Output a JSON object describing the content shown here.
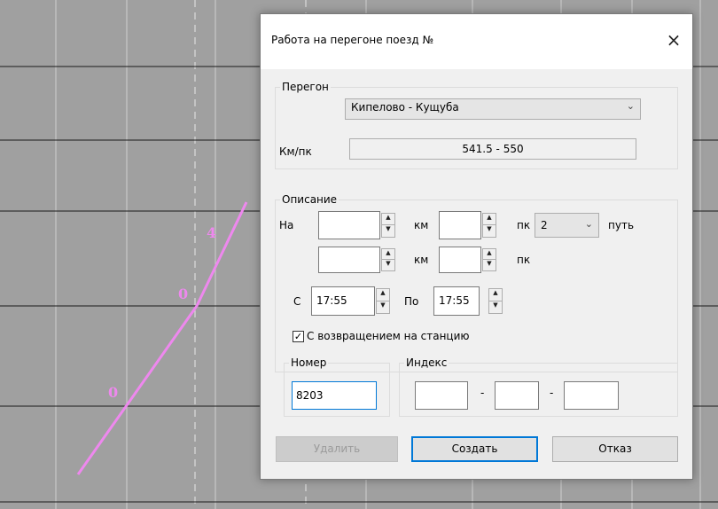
{
  "background": {
    "labels": [
      "4",
      "0",
      "0"
    ],
    "line_color": "#ee88ee"
  },
  "dialog": {
    "title": "Работа на перегоне поезд №",
    "close_icon": "×",
    "peregon": {
      "legend": "Перегон",
      "selected": "Кипелово - Кущуба",
      "km_pk_label": "Км/пк",
      "km_pk_value": "541.5 - 550"
    },
    "opisanie": {
      "legend": "Описание",
      "na_label": "На",
      "km_label": "км",
      "pk_label": "пк",
      "put_value": "2",
      "put_label": "путь",
      "km_label_2": "км",
      "pk_label_2": "пк",
      "s_label": "С",
      "s_time": "17:55",
      "po_label": "По",
      "po_time": "17:55",
      "return_label": "С возвращением на станцию"
    },
    "nomer": {
      "legend": "Номер",
      "value": "8203"
    },
    "index": {
      "legend": "Индекс",
      "sep1": "-",
      "sep2": "-"
    },
    "buttons": {
      "delete": "Удалить",
      "create": "Создать",
      "cancel": "Отказ"
    }
  }
}
